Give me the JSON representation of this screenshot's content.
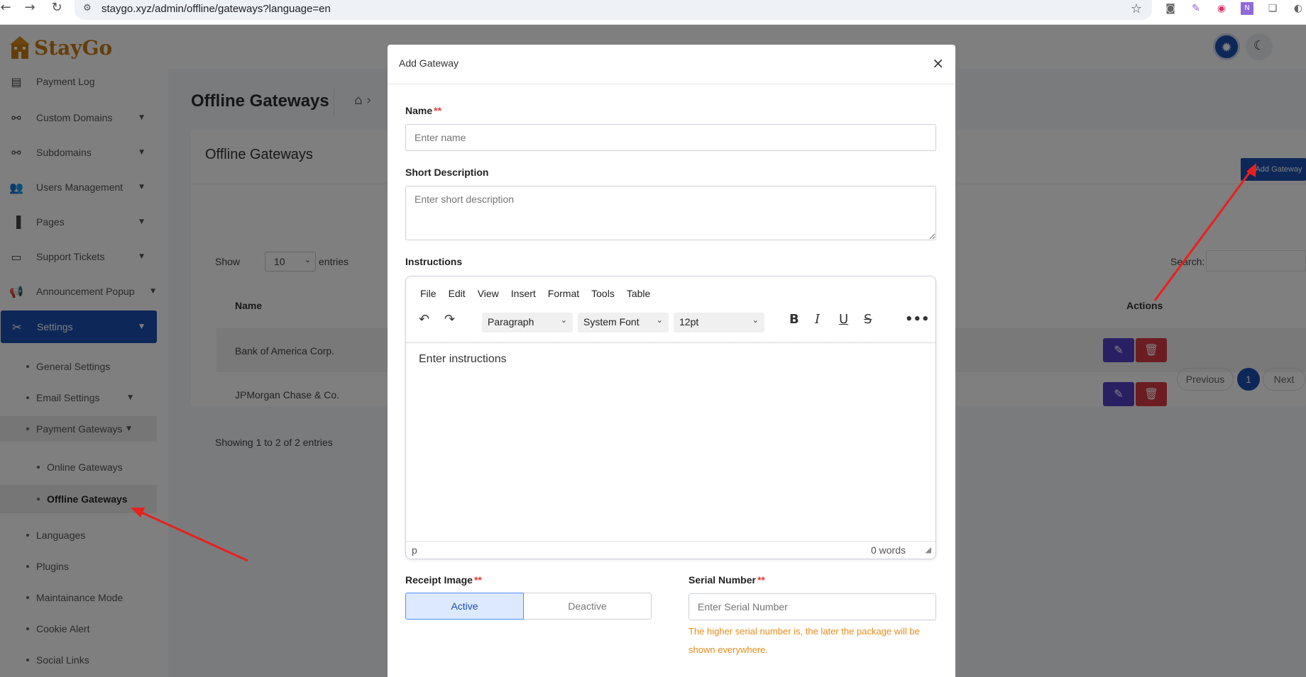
{
  "browser": {
    "url": "staygo.xyz/admin/offline/gateways?language=en"
  },
  "brand": {
    "name": "StayGo",
    "color": "#c97d12"
  },
  "sidebar": {
    "items": [
      {
        "label": "Payment Log",
        "icon": "payment-log-icon"
      },
      {
        "label": "Custom Domains",
        "icon": "link-icon"
      },
      {
        "label": "Subdomains",
        "icon": "link-icon"
      },
      {
        "label": "Users Management",
        "icon": "users-icon"
      },
      {
        "label": "Pages",
        "icon": "file-icon"
      },
      {
        "label": "Support Tickets",
        "icon": "ticket-icon"
      },
      {
        "label": "Announcement Popup",
        "icon": "megaphone-icon"
      },
      {
        "label": "Settings",
        "icon": "tools-icon"
      }
    ],
    "settings_sub": [
      {
        "label": "General Settings"
      },
      {
        "label": "Email Settings"
      },
      {
        "label": "Payment Gateways"
      },
      {
        "label": "Online Gateways"
      },
      {
        "label": "Offline Gateways"
      },
      {
        "label": "Languages"
      },
      {
        "label": "Plugins"
      },
      {
        "label": "Maintainance Mode"
      },
      {
        "label": "Cookie Alert"
      },
      {
        "label": "Social Links"
      }
    ]
  },
  "main": {
    "page_title": "Offline Gateways",
    "card_title": "Offline Gateways",
    "add_button": "Add Gateway",
    "show_label": "Show",
    "show_value": "10",
    "entries_label": "entries",
    "search_label": "Search:",
    "columns": {
      "name": "Name",
      "actions": "Actions"
    },
    "rows": [
      {
        "name": "Bank of America Corp."
      },
      {
        "name": "JPMorgan Chase & Co."
      }
    ],
    "showing": "Showing 1 to 2 of 2 entries",
    "pagination": {
      "previous": "Previous",
      "page": "1",
      "next": "Next"
    }
  },
  "modal": {
    "title": "Add Gateway",
    "close": "×",
    "name_label": "Name",
    "name_placeholder": "Enter name",
    "short_desc_label": "Short Description",
    "short_desc_placeholder": "Enter short description",
    "instructions_label": "Instructions",
    "editor": {
      "menu": [
        "File",
        "Edit",
        "View",
        "Insert",
        "Format",
        "Tools",
        "Table"
      ],
      "block_format": "Paragraph",
      "font_family": "System Font",
      "font_size": "12pt",
      "placeholder": "Enter instructions",
      "path": "p",
      "word_count": "0 words"
    },
    "receipt_label": "Receipt Image",
    "receipt_options": {
      "active": "Active",
      "deactive": "Deactive"
    },
    "serial_label": "Serial Number",
    "serial_placeholder": "Enter Serial Number",
    "serial_hint": "The higher serial number is, the later the package will be shown everywhere.",
    "required_mark": "**"
  },
  "colors": {
    "primary": "#1a4fb0",
    "edit": "#5340c9",
    "delete": "#d63a44",
    "hint": "#e88b1c",
    "annotation_arrow": "#e8201c"
  }
}
